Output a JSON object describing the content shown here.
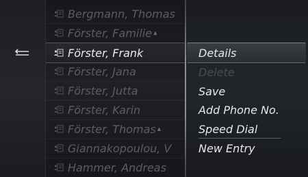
{
  "contacts": [
    {
      "name": "Bergmann, Thomas",
      "selected": false,
      "has_more": false
    },
    {
      "name": "Förster, Familie",
      "selected": false,
      "has_more": true
    },
    {
      "name": "Förster, Frank",
      "selected": true,
      "has_more": false
    },
    {
      "name": "Förster, Jana",
      "selected": false,
      "has_more": false
    },
    {
      "name": "Förster, Jutta",
      "selected": false,
      "has_more": false
    },
    {
      "name": "Förster, Karin",
      "selected": false,
      "has_more": false
    },
    {
      "name": "Förster, Thomas",
      "selected": false,
      "has_more": true
    },
    {
      "name": "Giannakopoulou, V",
      "selected": false,
      "has_more": false
    },
    {
      "name": "Hammer, Andreas",
      "selected": false,
      "has_more": false
    }
  ],
  "menu": {
    "details": "Details",
    "delete": "Delete",
    "save": "Save",
    "add_phone": "Add Phone No.",
    "speed_dial": "Speed Dial",
    "new_entry": "New Entry"
  },
  "colors": {
    "text_active": "#e9eaec",
    "text_inactive": "#5a5d62",
    "menu_disabled": "#4a4d52"
  },
  "icons": {
    "back": "back-arrow-icon",
    "contact": "contact-card-icon"
  }
}
